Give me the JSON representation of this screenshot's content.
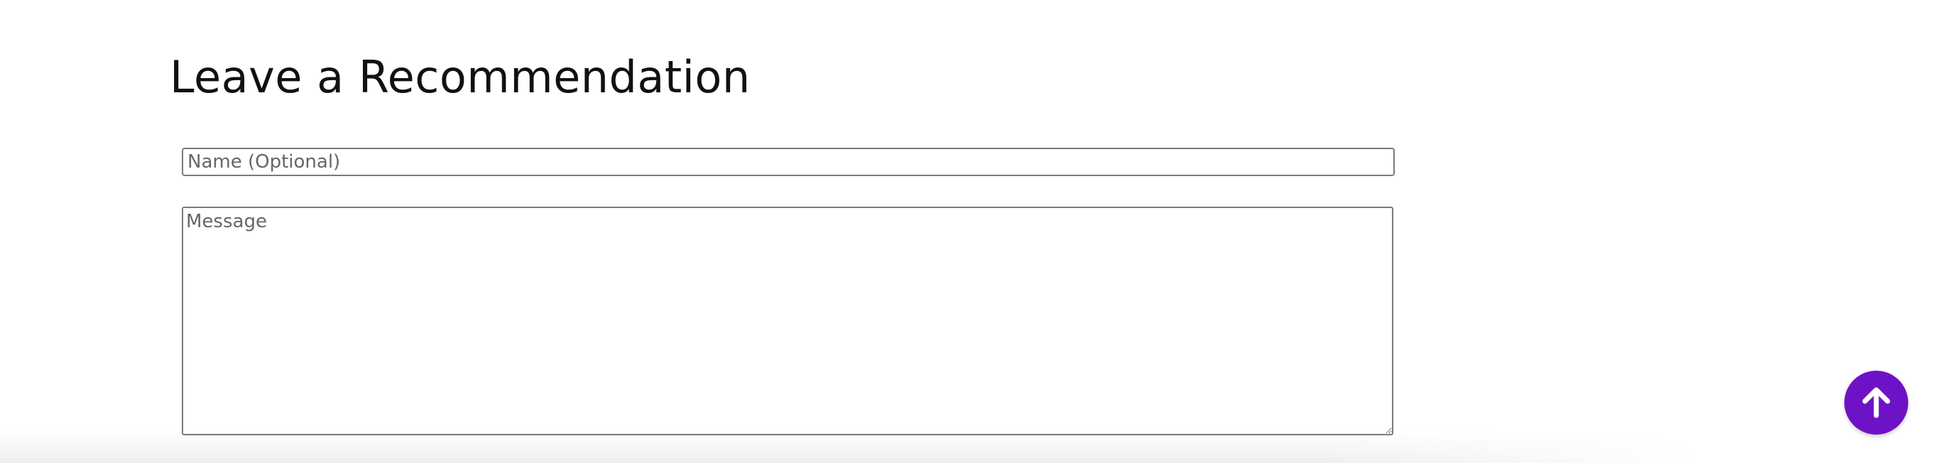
{
  "section": {
    "title": "Leave a Recommendation"
  },
  "form": {
    "name_placeholder": "Name (Optional)",
    "name_value": "",
    "message_placeholder": "Message",
    "message_value": ""
  },
  "scroll_to_top": {
    "icon": "arrow-up-icon",
    "color": "#6e12c7"
  }
}
